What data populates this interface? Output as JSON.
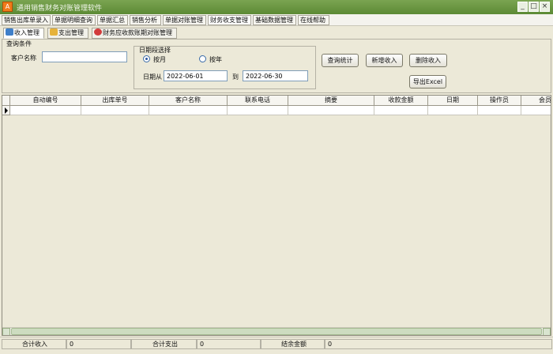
{
  "window": {
    "title": "通用销售财务对账管理软件"
  },
  "menu_tabs": [
    "销售出库单录入",
    "单据明细查询",
    "单据汇总",
    "销售分析",
    "单据对账管理",
    "财务收支管理",
    "基础数据管理",
    "在线帮助"
  ],
  "sub_tabs": [
    "收入管理",
    "支出管理",
    "财务应收款账期对账管理"
  ],
  "query": {
    "legend": "查询条件",
    "customer_label": "客户名称",
    "customer_value": "",
    "date_group": "日期段选择",
    "by_month": "按月",
    "by_year": "按年",
    "date_from_label": "日期从",
    "date_from": "2022-06-01",
    "date_to_label": "到",
    "date_to": "2022-06-30"
  },
  "buttons": {
    "query": "查询统计",
    "add": "新增收入",
    "delete": "删除收入",
    "export": "导出Excel"
  },
  "grid_headers": [
    "自动编号",
    "出库单号",
    "客户名称",
    "联系电话",
    "摘要",
    "收款金额",
    "日期",
    "操作员",
    "会员"
  ],
  "status": {
    "income_label": "合计收入",
    "income_value": "0",
    "expense_label": "合计支出",
    "expense_value": "0",
    "balance_label": "结余金额",
    "balance_value": "0"
  },
  "colors": {
    "titlebar": "#6a9a44",
    "accent": "#3b6ca8"
  }
}
